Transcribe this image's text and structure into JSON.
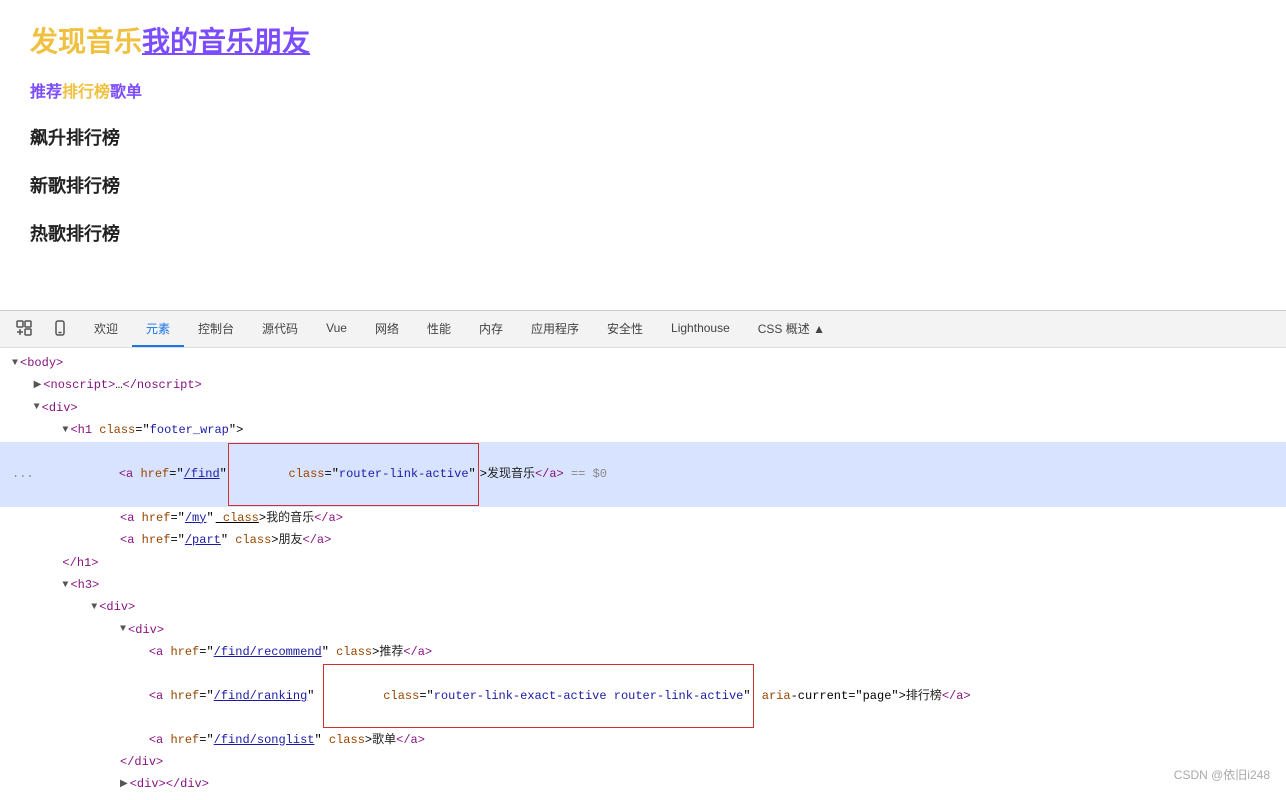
{
  "top": {
    "title_find": "发现音乐",
    "title_my": "我的音乐朋友",
    "nav_recommend": "推荐",
    "nav_ranking": "排行榜",
    "nav_songlist": "歌单",
    "chart1": "飙升排行榜",
    "chart2": "新歌排行榜",
    "chart3": "热歌排行榜"
  },
  "devtools": {
    "tabs": [
      {
        "label": "欢迎",
        "active": false
      },
      {
        "label": "元素",
        "active": true
      },
      {
        "label": "控制台",
        "active": false
      },
      {
        "label": "源代码",
        "active": false
      },
      {
        "label": "Vue",
        "active": false
      },
      {
        "label": "网络",
        "active": false
      },
      {
        "label": "性能",
        "active": false
      },
      {
        "label": "内存",
        "active": false
      },
      {
        "label": "应用程序",
        "active": false
      },
      {
        "label": "安全性",
        "active": false
      },
      {
        "label": "Lighthouse",
        "active": false
      },
      {
        "label": "CSS 概述 ▲",
        "active": false
      }
    ]
  },
  "watermark": "CSDN @依旧i248"
}
